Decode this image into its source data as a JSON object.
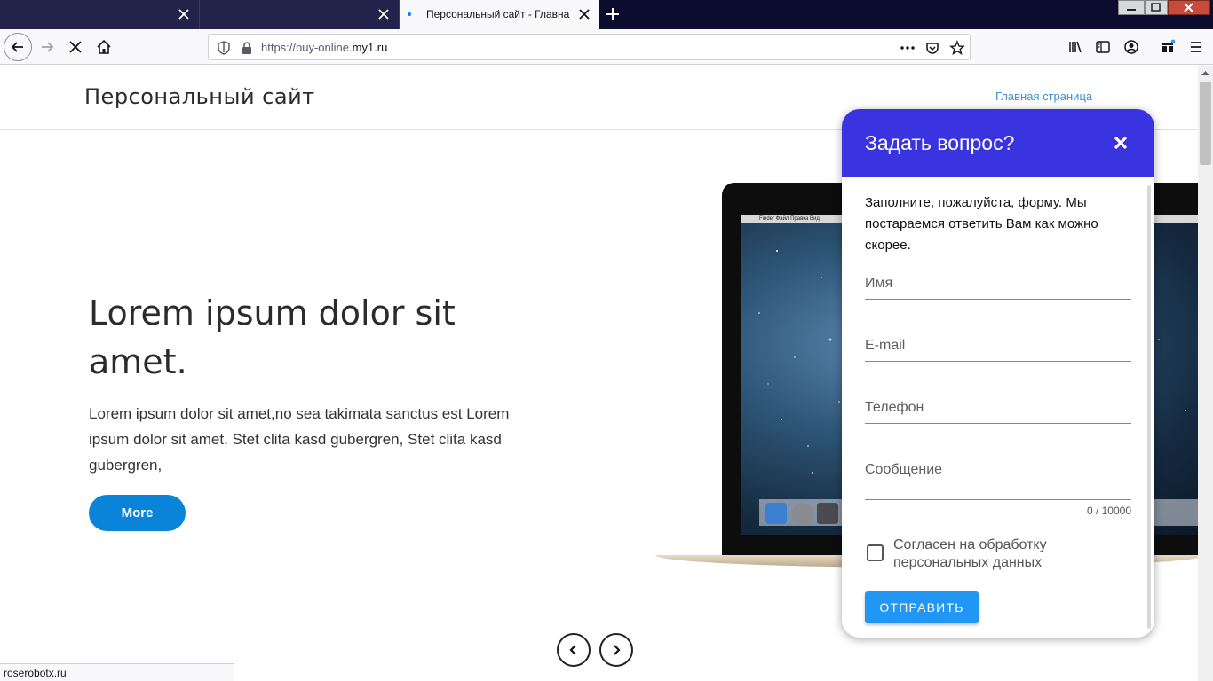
{
  "browser": {
    "tabs": [
      {
        "title": ""
      },
      {
        "title": ""
      },
      {
        "title": "Персональный сайт - Главная"
      }
    ],
    "url_prefix": "https://buy-online.",
    "url_domain": "my1.ru"
  },
  "site": {
    "title": "Персональный сайт",
    "nav_link": "Главная страница"
  },
  "hero": {
    "title": "Lorem ipsum dolor sit amet.",
    "text": "Lorem ipsum dolor sit amet,no sea takimata sanctus est Lorem ipsum dolor sit amet. Stet clita kasd gubergren, Stet clita kasd gubergren,",
    "button": "More"
  },
  "laptop_screen": {
    "menu": "Finder  Файл  Правка  Вид"
  },
  "dialog": {
    "title": "Задать вопрос?",
    "intro": "Заполните, пожалуйста, форму. Мы постараемся ответить Вам как можно скорее.",
    "name_placeholder": "Имя",
    "email_placeholder": "E-mail",
    "phone_placeholder": "Телефон",
    "message_placeholder": "Сообщение",
    "counter": "0 / 10000",
    "consent_label": "Согласен на обработку персональных данных",
    "submit": "ОТПРАВИТЬ"
  },
  "status_bar": "roserobotx.ru"
}
